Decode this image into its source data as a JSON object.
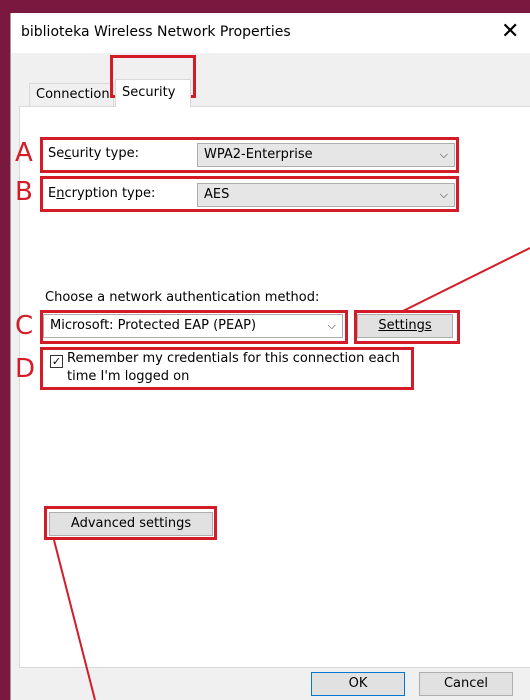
{
  "window": {
    "title": "biblioteka Wireless Network Properties",
    "close": "✕"
  },
  "tabs": [
    {
      "label": "Connection"
    },
    {
      "label": "Security"
    }
  ],
  "security_type": {
    "label": "Security type:",
    "value": "WPA2-Enterprise"
  },
  "encryption_type": {
    "label": "Encryption type:",
    "value": "AES"
  },
  "auth": {
    "label": "Choose a network authentication method:",
    "value": "Microsoft: Protected EAP (PEAP)",
    "settings_button": "Settings"
  },
  "remember": {
    "checked": true,
    "line1": "Remember my credentials for this connection each",
    "line2": "time I'm logged on"
  },
  "advanced_button": "Advanced settings",
  "ok_button": "OK",
  "cancel_button": "Cancel",
  "annotations": {
    "a": "A",
    "b": "B",
    "c": "C",
    "d": "D"
  },
  "colors": {
    "annotation": "#d41c28",
    "background": "#7a1840"
  }
}
